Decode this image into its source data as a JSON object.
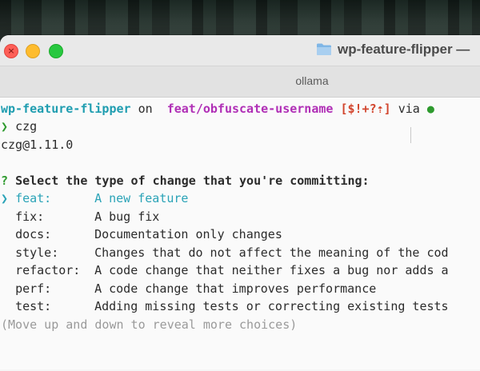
{
  "window": {
    "title": "wp-feature-flipper —",
    "tab_title": "ollama"
  },
  "prompt": {
    "dir": "wp-feature-flipper",
    "on": "on",
    "branch_icon": "",
    "branch": "feat/obfuscate-username",
    "status": "[$!+?⇡]",
    "via": "via",
    "runtime_icon": "●",
    "symbol": "❯",
    "command": "czg"
  },
  "output": {
    "version": "czg@1.11.0",
    "question_mark": "?",
    "question": "Select the type of change that you're committing:",
    "pointer": "❯",
    "choices": [
      {
        "type": "feat:",
        "desc": "A new feature",
        "selected": true
      },
      {
        "type": "fix:",
        "desc": "A bug fix",
        "selected": false
      },
      {
        "type": "docs:",
        "desc": "Documentation only changes",
        "selected": false
      },
      {
        "type": "style:",
        "desc": "Changes that do not affect the meaning of the cod",
        "selected": false
      },
      {
        "type": "refactor:",
        "desc": "A code change that neither fixes a bug nor adds a",
        "selected": false
      },
      {
        "type": "perf:",
        "desc": "A code change that improves performance",
        "selected": false
      },
      {
        "type": "test:",
        "desc": "Adding missing tests or correcting existing tests",
        "selected": false
      }
    ],
    "hint": "(Move up and down to reveal more choices)"
  },
  "colors": {
    "prompt_dir": "#1f9db0",
    "branch": "#b02fb6",
    "status": "#d2452d",
    "prompt_symbol": "#2e9a2e",
    "selected_choice": "#2aa3b7"
  }
}
